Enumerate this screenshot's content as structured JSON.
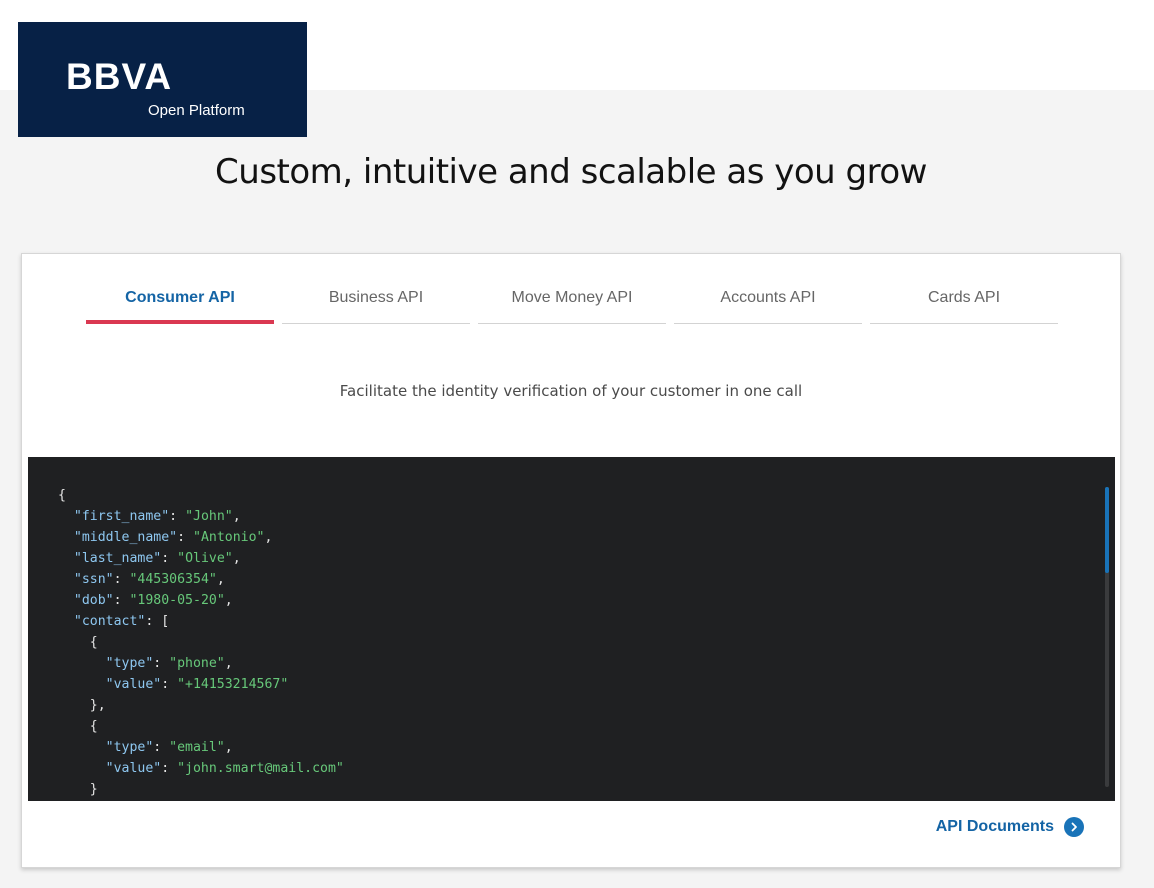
{
  "brand": {
    "logo_text": "BBVA",
    "sub_text": "Open Platform",
    "bg_color": "#072146"
  },
  "headline": "Custom, intuitive and scalable as you grow",
  "tabs": [
    {
      "label": "Consumer API",
      "active": true
    },
    {
      "label": "Business API",
      "active": false
    },
    {
      "label": "Move Money API",
      "active": false
    },
    {
      "label": "Accounts API",
      "active": false
    },
    {
      "label": "Cards API",
      "active": false
    }
  ],
  "description": "Facilitate the identity verification of your customer in one call",
  "code_lines": [
    [
      {
        "t": "p",
        "v": "{"
      }
    ],
    [
      {
        "t": "p",
        "v": "  "
      },
      {
        "t": "k",
        "v": "\"first_name\""
      },
      {
        "t": "p",
        "v": ": "
      },
      {
        "t": "s",
        "v": "\"John\""
      },
      {
        "t": "p",
        "v": ","
      }
    ],
    [
      {
        "t": "p",
        "v": "  "
      },
      {
        "t": "k",
        "v": "\"middle_name\""
      },
      {
        "t": "p",
        "v": ": "
      },
      {
        "t": "s",
        "v": "\"Antonio\""
      },
      {
        "t": "p",
        "v": ","
      }
    ],
    [
      {
        "t": "p",
        "v": "  "
      },
      {
        "t": "k",
        "v": "\"last_name\""
      },
      {
        "t": "p",
        "v": ": "
      },
      {
        "t": "s",
        "v": "\"Olive\""
      },
      {
        "t": "p",
        "v": ","
      }
    ],
    [
      {
        "t": "p",
        "v": "  "
      },
      {
        "t": "k",
        "v": "\"ssn\""
      },
      {
        "t": "p",
        "v": ": "
      },
      {
        "t": "s",
        "v": "\"445306354\""
      },
      {
        "t": "p",
        "v": ","
      }
    ],
    [
      {
        "t": "p",
        "v": "  "
      },
      {
        "t": "k",
        "v": "\"dob\""
      },
      {
        "t": "p",
        "v": ": "
      },
      {
        "t": "s",
        "v": "\"1980-05-20\""
      },
      {
        "t": "p",
        "v": ","
      }
    ],
    [
      {
        "t": "p",
        "v": "  "
      },
      {
        "t": "k",
        "v": "\"contact\""
      },
      {
        "t": "p",
        "v": ": ["
      }
    ],
    [
      {
        "t": "p",
        "v": "    {"
      }
    ],
    [
      {
        "t": "p",
        "v": "      "
      },
      {
        "t": "k",
        "v": "\"type\""
      },
      {
        "t": "p",
        "v": ": "
      },
      {
        "t": "s",
        "v": "\"phone\""
      },
      {
        "t": "p",
        "v": ","
      }
    ],
    [
      {
        "t": "p",
        "v": "      "
      },
      {
        "t": "k",
        "v": "\"value\""
      },
      {
        "t": "p",
        "v": ": "
      },
      {
        "t": "s",
        "v": "\"+14153214567\""
      }
    ],
    [
      {
        "t": "p",
        "v": "    },"
      }
    ],
    [
      {
        "t": "p",
        "v": "    {"
      }
    ],
    [
      {
        "t": "p",
        "v": "      "
      },
      {
        "t": "k",
        "v": "\"type\""
      },
      {
        "t": "p",
        "v": ": "
      },
      {
        "t": "s",
        "v": "\"email\""
      },
      {
        "t": "p",
        "v": ","
      }
    ],
    [
      {
        "t": "p",
        "v": "      "
      },
      {
        "t": "k",
        "v": "\"value\""
      },
      {
        "t": "p",
        "v": ": "
      },
      {
        "t": "s",
        "v": "\"john.smart@mail.com\""
      }
    ],
    [
      {
        "t": "p",
        "v": "    }"
      }
    ]
  ],
  "docs_link": {
    "label": "API Documents",
    "icon": "chevron-right-circle-icon"
  },
  "colors": {
    "accent_blue": "#1464a5",
    "active_underline": "#da3851",
    "code_bg": "#1f2022",
    "code_key": "#8ec7f0",
    "code_string": "#67c87a"
  }
}
